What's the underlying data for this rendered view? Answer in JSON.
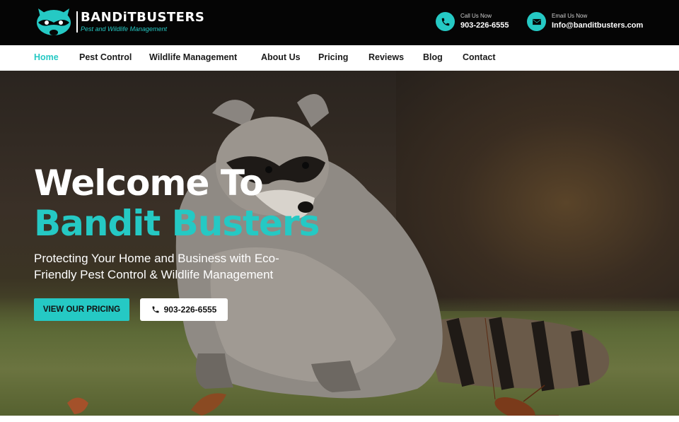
{
  "brand": {
    "name": "BANDiTBUSTERS",
    "tagline": "Pest and Wildlife Management",
    "accent_color": "#25c9c4"
  },
  "contact": {
    "phone_label": "Call Us Now",
    "phone_value": "903-226-6555",
    "email_label": "Email Us Now",
    "email_value": "Info@banditbusters.com"
  },
  "nav": {
    "items": [
      {
        "label": "Home",
        "active": true
      },
      {
        "label": "Pest Control"
      },
      {
        "label": "Wildlife Management"
      },
      {
        "label": "About Us"
      },
      {
        "label": "Pricing"
      },
      {
        "label": "Reviews"
      },
      {
        "label": "Blog"
      },
      {
        "label": "Contact"
      }
    ]
  },
  "hero": {
    "title_line1": "Welcome To",
    "title_line2": "Bandit Busters",
    "subtitle": "Protecting Your Home and Business with Eco-Friendly Pest Control & Wildlife Management",
    "primary_button": "VIEW OUR PRICING",
    "phone_button": "903-226-6555"
  },
  "icons": {
    "logo": "raccoon-logo-icon",
    "phone": "phone-icon",
    "email": "envelope-icon"
  }
}
